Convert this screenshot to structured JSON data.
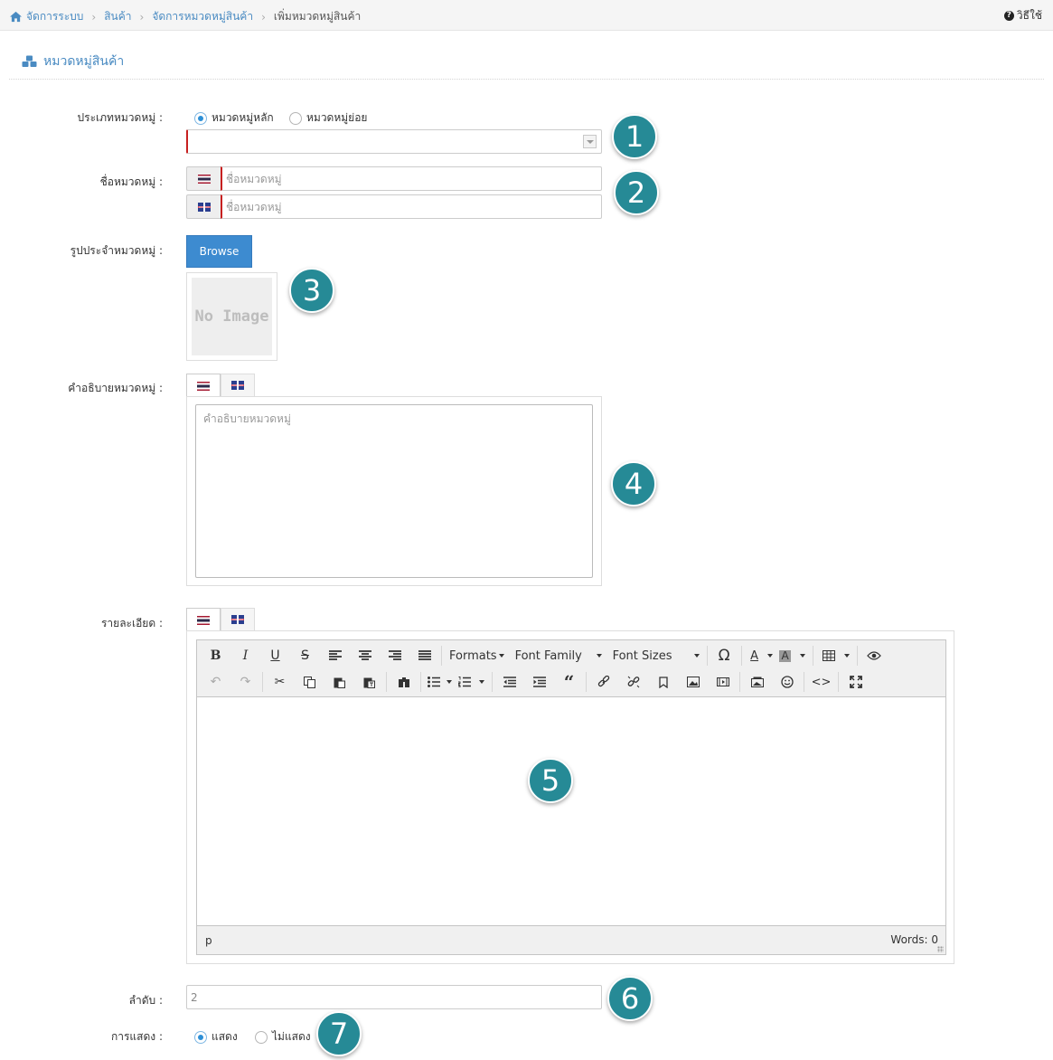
{
  "breadcrumb": {
    "items": [
      "จัดการระบบ",
      "สินค้า",
      "จัดการหมวดหมู่สินค้า"
    ],
    "current": "เพิ่มหมวดหมู่สินค้า",
    "help": "วิธีใช้"
  },
  "page": {
    "title": "หมวดหมู่สินค้า"
  },
  "form": {
    "type": {
      "label": "ประเภทหมวดหมู่ :",
      "options": [
        "หมวดหมู่หลัก",
        "หมวดหมู่ย่อย"
      ],
      "selected": "หมวดหมู่หลัก"
    },
    "name": {
      "label": "ชื่อหมวดหมู่ :",
      "placeholder_th": "ชื่อหมวดหมู่",
      "placeholder_en": "ชื่อหมวดหมู่"
    },
    "image": {
      "label": "รูปประจำหมวดหมู่ :",
      "browse": "Browse",
      "no_image": "No Image"
    },
    "description": {
      "label": "คำอธิบายหมวดหมู่ :",
      "placeholder": "คำอธิบายหมวดหมู่"
    },
    "detail": {
      "label": "รายละเอียด :",
      "toolbar": {
        "formats": "Formats",
        "font_family": "Font Family",
        "font_sizes": "Font Sizes"
      },
      "status_path": "p",
      "status_words": "Words: 0"
    },
    "order": {
      "label": "ลำดับ :",
      "value": "2"
    },
    "display": {
      "label": "การแสดง :",
      "options": [
        "แสดง",
        "ไม่แสดง"
      ],
      "selected": "แสดง"
    }
  },
  "badges": [
    "1",
    "2",
    "3",
    "4",
    "5",
    "6",
    "7"
  ],
  "colors": {
    "accent": "#4a8bc2",
    "badge": "#268a96",
    "required": "#c72020",
    "button": "#3d8bd0"
  }
}
